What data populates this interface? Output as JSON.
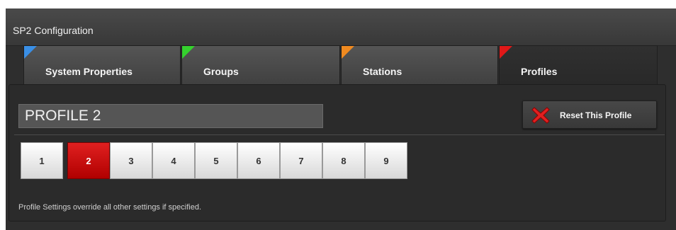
{
  "window": {
    "title": "SP2 Configuration"
  },
  "tabs": [
    {
      "label": "System Properties",
      "corner_color": "#3a8fe6",
      "active": false
    },
    {
      "label": "Groups",
      "corner_color": "#35d12e",
      "active": false
    },
    {
      "label": "Stations",
      "corner_color": "#f08a20",
      "active": false
    },
    {
      "label": "Profiles",
      "corner_color": "#e01818",
      "active": true
    }
  ],
  "profile": {
    "name": "PROFILE 2",
    "reset_label": "Reset This Profile",
    "numbers": [
      "1",
      "2",
      "3",
      "4",
      "5",
      "6",
      "7",
      "8",
      "9"
    ],
    "selected": "2",
    "note": "Profile Settings override all other settings if specified."
  },
  "colors": {
    "selected": "#d01010",
    "reset_icon": "#e02020"
  },
  "icons": {
    "reset": "x-icon"
  }
}
